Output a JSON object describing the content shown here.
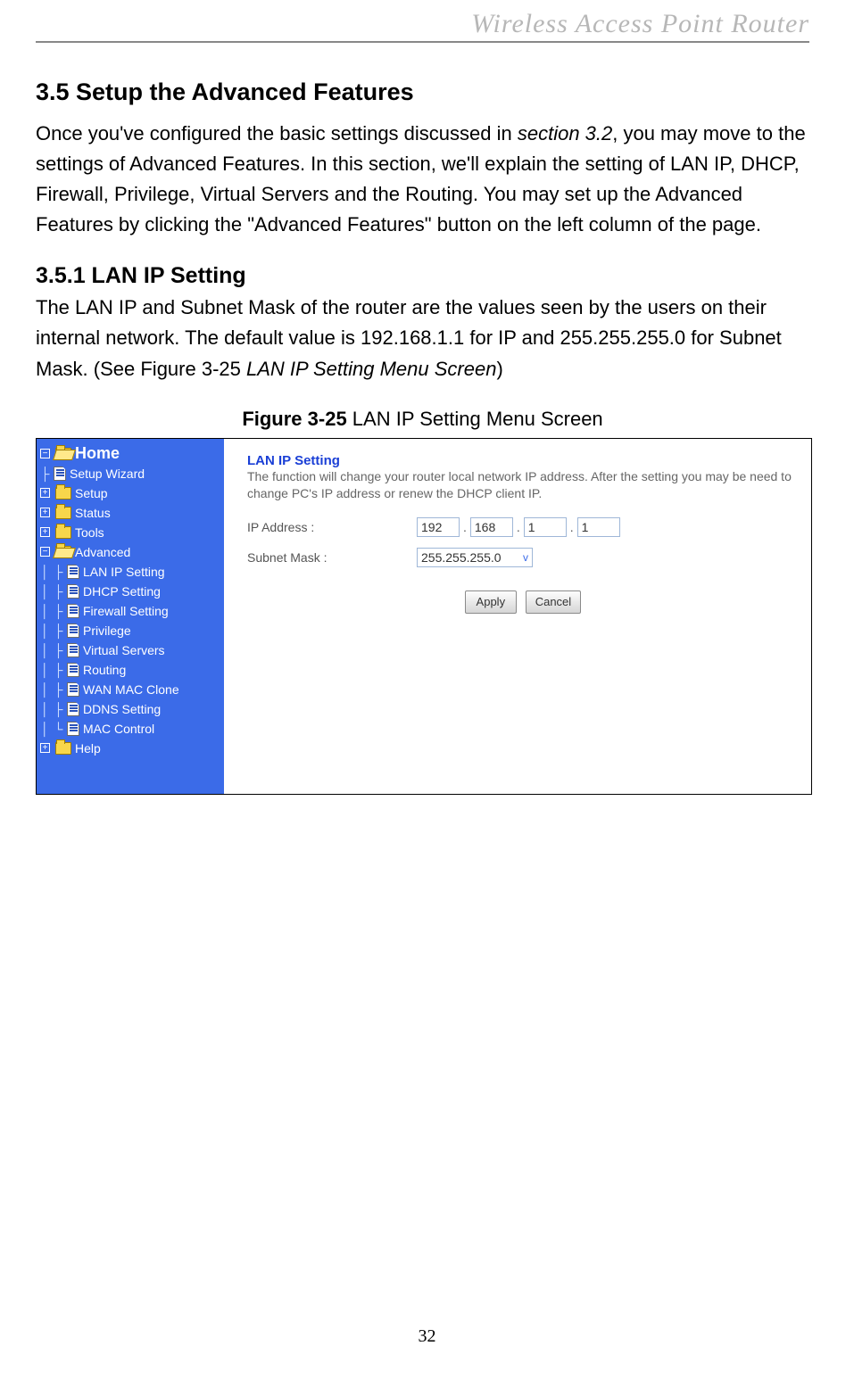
{
  "runningHeader": "Wireless  Access  Point  Router",
  "section35": {
    "heading": "3.5 Setup the Advanced Features",
    "paraPart1": "Once you've configured the basic settings discussed in ",
    "paraItalic1": "section 3.2",
    "paraPart2": ", you may move to the settings of Advanced Features. In this section, we'll explain the setting of LAN IP, DHCP, Firewall, Privilege, Virtual Servers and the Routing. You may set up the Advanced Features by clicking the \"Advanced Features\" button on the left column of the page."
  },
  "section351": {
    "heading": "3.5.1 LAN IP Setting",
    "paraPart1": "The LAN IP and Subnet Mask of the router are the values seen by the users on their internal network. The default value is 192.168.1.1 for IP and 255.255.255.0 for Subnet Mask. (See Figure 3-25 ",
    "paraItalic1": "LAN IP Setting Menu Screen",
    "paraPart2": ")"
  },
  "figureCaption": {
    "bold": "Figure 3-25",
    "rest": " LAN IP Setting Menu Screen"
  },
  "tree": {
    "home": "Home",
    "setupWizard": "Setup Wizard",
    "setup": "Setup",
    "status": "Status",
    "tools": "Tools",
    "advanced": "Advanced",
    "children": {
      "lanip": "LAN IP Setting",
      "dhcp": "DHCP Setting",
      "firewall": "Firewall Setting",
      "privilege": "Privilege",
      "virtual": "Virtual Servers",
      "routing": "Routing",
      "wanmac": "WAN MAC Clone",
      "ddns": "DDNS Setting",
      "macctrl": "MAC Control"
    },
    "help": "Help"
  },
  "panel": {
    "title": "LAN IP Setting",
    "desc": "The function will change your router local network IP address. After the setting you may be need to change PC's IP address or renew the DHCP client IP.",
    "ipLabel": "IP Address :",
    "ip": {
      "a": "192",
      "b": "168",
      "c": "1",
      "d": "1"
    },
    "maskLabel": "Subnet Mask :",
    "maskValue": "255.255.255.0",
    "apply": "Apply",
    "cancel": "Cancel"
  },
  "pageNumber": "32"
}
